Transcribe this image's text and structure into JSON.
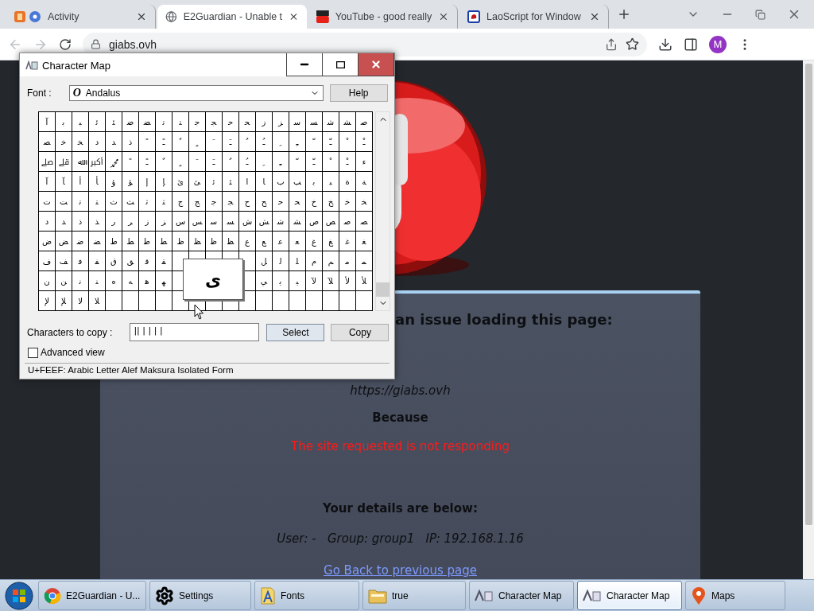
{
  "browser": {
    "tabs": [
      {
        "title": "Activity",
        "kind": "activity",
        "selected": false
      },
      {
        "title": "E2Guardian - Unable t",
        "kind": "globe",
        "selected": true
      },
      {
        "title": "YouTube - good really",
        "kind": "youtube",
        "selected": false
      },
      {
        "title": "LaoScript for Window",
        "kind": "laoscript",
        "selected": false
      }
    ],
    "address": "giabs.ovh",
    "profile": "M"
  },
  "page": {
    "heading": "an issue loading this page:",
    "url": "https://giabs.ovh",
    "because": "Because",
    "reason": "The site requested is not responding",
    "details_heading": "Your details are below:",
    "details": "User: -   Group: group1   IP: 192.168.1.16",
    "back_link": "Go Back to previous page"
  },
  "character_map": {
    "title": "Character Map",
    "font_label": "Font :",
    "font_icon": "O",
    "font": "Andalus",
    "help": "Help",
    "grid": [
      [
        "ﺻ",
        "ﺸ",
        "ﺷ",
        "ﺴ",
        "ﺳ",
        "ﺰ",
        "ﺯ",
        "ﺤ",
        "ﺣ",
        "ﺠ",
        "ﺟ",
        "ﺘ",
        "ﺗ",
        "ﻀ",
        "ﺿ",
        "ﺌ",
        "ﺋ",
        "ﺒ",
        "ﺑ",
        "ﺁ"
      ],
      [
        "ﹿ",
        "ﹾ",
        "ﹽ",
        "ﹼ",
        "ﹻ",
        "ﹺ",
        "ﹹ",
        "ﹸ",
        "ﹷ",
        "ﹶ",
        "ﹴ",
        "ﹲ",
        "ﹱ",
        "ﹰ",
        "ﺫ",
        "ﺪ",
        "ﺩ",
        "ﺨ",
        "ﺧ",
        "ﺼ"
      ],
      [
        "ﺀ",
        "ﹿ",
        "ﹾ",
        "ﹽ",
        "ﹼ",
        "ﹻ",
        "ﹺ",
        "ﹹ",
        "ﹸ",
        "ﹷ",
        "ﹶ",
        "ﹴ",
        "ﹲ",
        "ﹱ",
        "ﹰ",
        "ﷴ",
        "ﷳ",
        "ﷲ",
        "ﷱ",
        "ﷰ"
      ],
      [
        "ﺔ",
        "ﺓ",
        "ﺒ",
        "ﺑ",
        "ﺐ",
        "ﺏ",
        "ﺎ",
        "ﺍ",
        "ﺌ",
        "ﺋ",
        "ﺊ",
        "ﺉ",
        "ﺈ",
        "ﺇ",
        "ﺆ",
        "ﺅ",
        "ﺄ",
        "ﺃ",
        "ﺂ",
        "ﺁ"
      ],
      [
        "ﺨ",
        "ﺧ",
        "ﺦ",
        "ﺥ",
        "ﺤ",
        "ﺣ",
        "ﺢ",
        "ﺡ",
        "ﺠ",
        "ﺟ",
        "ﺞ",
        "ﺝ",
        "ﺜ",
        "ﺛ",
        "ﺚ",
        "ﺙ",
        "ﺘ",
        "ﺗ",
        "ﺖ",
        "ﺕ"
      ],
      [
        "ﺼ",
        "ﺻ",
        "ﺺ",
        "ﺹ",
        "ﺸ",
        "ﺷ",
        "ﺶ",
        "ﺵ",
        "ﺴ",
        "ﺳ",
        "ﺲ",
        "ﺱ",
        "ﺰ",
        "ﺯ",
        "ﺮ",
        "ﺭ",
        "ﺬ",
        "ﺫ",
        "ﺪ",
        "ﺩ"
      ],
      [
        "ﻐ",
        "ﻏ",
        "ﻎ",
        "ﻍ",
        "ﻌ",
        "ﻋ",
        "ﻊ",
        "ﻉ",
        "ﻈ",
        "ﻇ",
        "ﻆ",
        "ﻅ",
        "ﻄ",
        "ﻃ",
        "ﻂ",
        "ﻁ",
        "ﻀ",
        "ﺿ",
        "ﺾ",
        "ﺽ"
      ],
      {
        "right": [
          "ﻤ",
          "ﻣ",
          "ﻢ",
          "ﻡ",
          "ﻠ",
          "ﻟ",
          "ﻞ"
        ],
        "left": [
          "ﻘ",
          "ﻗ",
          "ﻖ",
          "ﻕ",
          "ﻔ",
          "ﻓ",
          "ﻒ",
          "ﻑ"
        ]
      },
      {
        "right": [
          "ﻸ",
          "ﻷ",
          "ﻶ",
          "ﻵ",
          "ﻴ",
          "ﻳ",
          "ﻲ"
        ],
        "left": [
          "ﻬ",
          "ﻫ",
          "ﻪ",
          "ﻩ",
          "ﻨ",
          "ﻧ",
          "ﻦ",
          "ﻥ"
        ]
      },
      [
        "ﻼ",
        "ﻻ",
        "ﻺ",
        "ﻹ"
      ]
    ],
    "zoomed": "ﻯ",
    "copy_label": "Characters to copy :",
    "copy_value": "|| | | | |",
    "select": "Select",
    "copy": "Copy",
    "advanced": {
      "label": "Advanced view",
      "checked": false
    },
    "status": "U+FEEF: Arabic Letter Alef Maksura Isolated Form"
  },
  "taskbar": {
    "items": [
      {
        "label": "E2Guardian - U...",
        "kind": "chrome",
        "selected": false
      },
      {
        "label": "Settings",
        "kind": "gear",
        "selected": false
      },
      {
        "label": "Fonts",
        "kind": "fonts",
        "selected": false
      },
      {
        "label": "true",
        "kind": "folder",
        "selected": false
      },
      {
        "label": "Character Map",
        "kind": "charmap",
        "selected": false
      },
      {
        "label": "Character Map",
        "kind": "charmap",
        "selected": true
      },
      {
        "label": "Maps",
        "kind": "maps",
        "selected": false
      }
    ]
  }
}
